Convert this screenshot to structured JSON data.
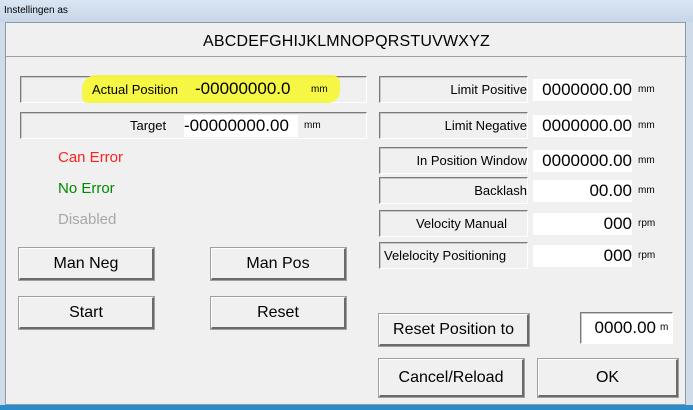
{
  "window": {
    "title": "Instellingen as"
  },
  "heading": "ABCDEFGHIJKLMNOPQRSTUVWXYZ",
  "colors": {
    "can_error": "#ff2020",
    "no_error": "#008a00",
    "disabled": "#a8a8a8",
    "highlight": "#f6f53a"
  },
  "left": {
    "actual_position": {
      "label": "Actual Position",
      "value": "-00000000.0",
      "unit": "mm"
    },
    "target": {
      "label": "Target",
      "value": "-00000000.00",
      "unit": "mm"
    },
    "status": {
      "can_error": "Can Error",
      "no_error": "No Error",
      "disabled": "Disabled"
    },
    "buttons": {
      "man_neg": "Man Neg",
      "man_pos": "Man Pos",
      "start": "Start",
      "reset": "Reset"
    }
  },
  "right": {
    "limit_positive": {
      "label": "Limit Positive",
      "value": "0000000.00",
      "unit": "mm"
    },
    "limit_negative": {
      "label": "Limit Negative",
      "value": "0000000.00",
      "unit": "mm"
    },
    "in_position_window": {
      "label": "In Position Window",
      "value": "0000000.00",
      "unit": "mm"
    },
    "backlash": {
      "label": "Backlash",
      "value": "00.00",
      "unit": "mm"
    },
    "velocity_manual": {
      "label": "Velocity  Manual",
      "value": "000",
      "unit": "rpm"
    },
    "velocity_positioning": {
      "label": "Velelocity Positioning",
      "value": "000",
      "unit": "rpm"
    },
    "reset_position": {
      "button": "Reset Position to",
      "value": "0000.00",
      "unit": "m"
    },
    "buttons": {
      "cancel_reload": "Cancel/Reload",
      "ok": "OK"
    }
  }
}
